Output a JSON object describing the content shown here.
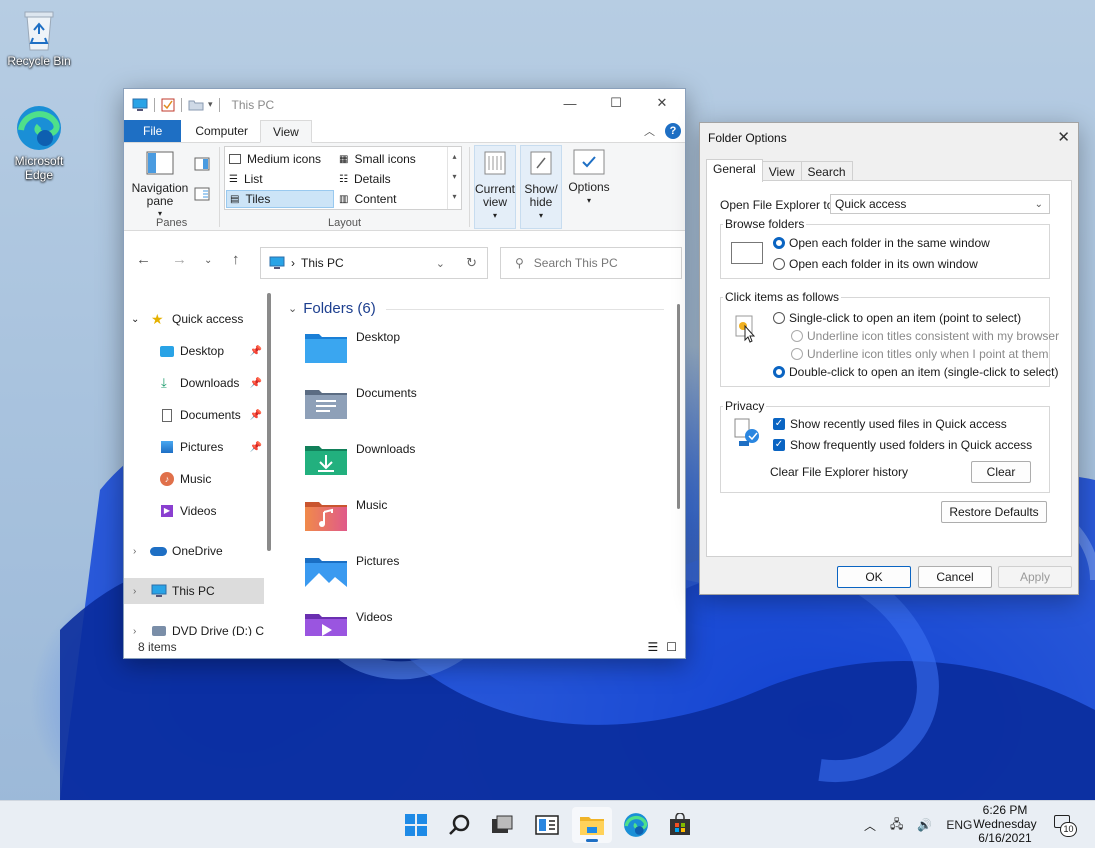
{
  "desktop": {
    "icons": [
      {
        "label": "Recycle Bin",
        "icon": "recycle-bin-icon"
      },
      {
        "label": "Microsoft Edge",
        "icon": "edge-icon"
      }
    ]
  },
  "explorer": {
    "title": "This PC",
    "tabs": [
      "File",
      "Computer",
      "View"
    ],
    "active_tab": "View",
    "ribbon": {
      "panes": {
        "nav_pane_label": "Navigation pane",
        "group_label": "Panes"
      },
      "layout": {
        "items": [
          "Medium icons",
          "Small icons",
          "List",
          "Details",
          "Tiles",
          "Content"
        ],
        "selected": "Tiles",
        "group_label": "Layout"
      },
      "current_view": "Current view",
      "show_hide": "Show/ hide",
      "options": "Options"
    },
    "address": {
      "path": "This PC"
    },
    "search": {
      "placeholder": "Search This PC"
    },
    "nav_pane": [
      {
        "label": "Quick access",
        "icon": "star-icon",
        "pinned": false,
        "expanded": true
      },
      {
        "label": "Desktop",
        "icon": "desktop-folder-icon",
        "pinned": true
      },
      {
        "label": "Downloads",
        "icon": "download-icon",
        "pinned": true
      },
      {
        "label": "Documents",
        "icon": "document-icon",
        "pinned": true
      },
      {
        "label": "Pictures",
        "icon": "pictures-icon",
        "pinned": true
      },
      {
        "label": "Music",
        "icon": "music-icon",
        "pinned": false
      },
      {
        "label": "Videos",
        "icon": "videos-icon",
        "pinned": false
      },
      {
        "label": "OneDrive",
        "icon": "cloud-icon",
        "pinned": false
      },
      {
        "label": "This PC",
        "icon": "monitor-icon",
        "pinned": false,
        "selected": true
      },
      {
        "label": "DVD Drive (D:) CC",
        "icon": "dvd-icon",
        "pinned": false
      }
    ],
    "folders_header": "Folders (6)",
    "folders": [
      {
        "name": "Desktop",
        "color": "#2d8fe0"
      },
      {
        "name": "Documents",
        "color": "#6d7f99"
      },
      {
        "name": "Downloads",
        "color": "#1a9b6b"
      },
      {
        "name": "Music",
        "color": "#e0704a"
      },
      {
        "name": "Pictures",
        "color": "#2a86e0"
      },
      {
        "name": "Videos",
        "color": "#8a3fd0"
      }
    ],
    "status": "8 items"
  },
  "folder_options": {
    "title": "Folder Options",
    "tabs": [
      "General",
      "View",
      "Search"
    ],
    "active_tab": "General",
    "open_to_label": "Open File Explorer to:",
    "open_to_value": "Quick access",
    "browse": {
      "legend": "Browse folders",
      "opt1": "Open each folder in the same window",
      "opt2": "Open each folder in its own window"
    },
    "click": {
      "legend": "Click items as follows",
      "single": "Single-click to open an item (point to select)",
      "underline1": "Underline icon titles consistent with my browser",
      "underline2": "Underline icon titles only when I point at them",
      "double": "Double-click to open an item (single-click to select)"
    },
    "privacy": {
      "legend": "Privacy",
      "recent_files": "Show recently used files in Quick access",
      "frequent_folders": "Show frequently used folders in Quick access",
      "clear_label": "Clear File Explorer history",
      "clear_button": "Clear"
    },
    "restore_defaults": "Restore Defaults",
    "ok": "OK",
    "cancel": "Cancel",
    "apply": "Apply",
    "accent": "#0a64c2"
  },
  "taskbar": {
    "apps": [
      "start-icon",
      "search-icon",
      "task-view-icon",
      "widgets-icon",
      "file-explorer-icon",
      "edge-icon",
      "store-icon"
    ],
    "active_app": "file-explorer-icon",
    "tray": {
      "language": "ENG",
      "notification_count": "10"
    },
    "clock": {
      "time": "6:26 PM",
      "day": "Wednesday",
      "date": "6/16/2021"
    }
  }
}
